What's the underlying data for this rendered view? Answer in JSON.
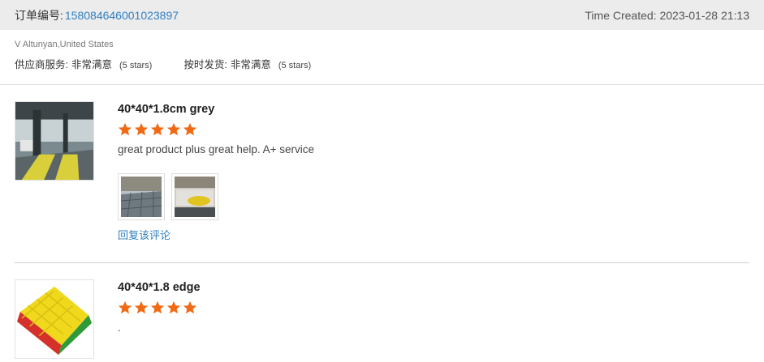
{
  "header": {
    "order_label": "订单编号:",
    "order_number": "15808464600102389​7",
    "time_created": "Time Created: 2023-01-28 21:13"
  },
  "buyer": {
    "name": "V Altunyan,United States",
    "ratings": [
      {
        "label": "供应商服务:",
        "value": "非常满意",
        "note": "(5 stars)"
      },
      {
        "label": "按时发货:",
        "value": "非常满意",
        "note": "(5 stars)"
      }
    ]
  },
  "reviews": [
    {
      "title": "40*40*1.8cm grey",
      "stars": 5,
      "comment": "great product plus great help. A+ service",
      "reply_label": "回复该评论"
    },
    {
      "title": "40*40*1.8 edge",
      "stars": 5,
      "comment": "."
    }
  ],
  "colors": {
    "star": "#f06a16",
    "link": "#2f7fc1",
    "header_bg": "#ececec"
  }
}
